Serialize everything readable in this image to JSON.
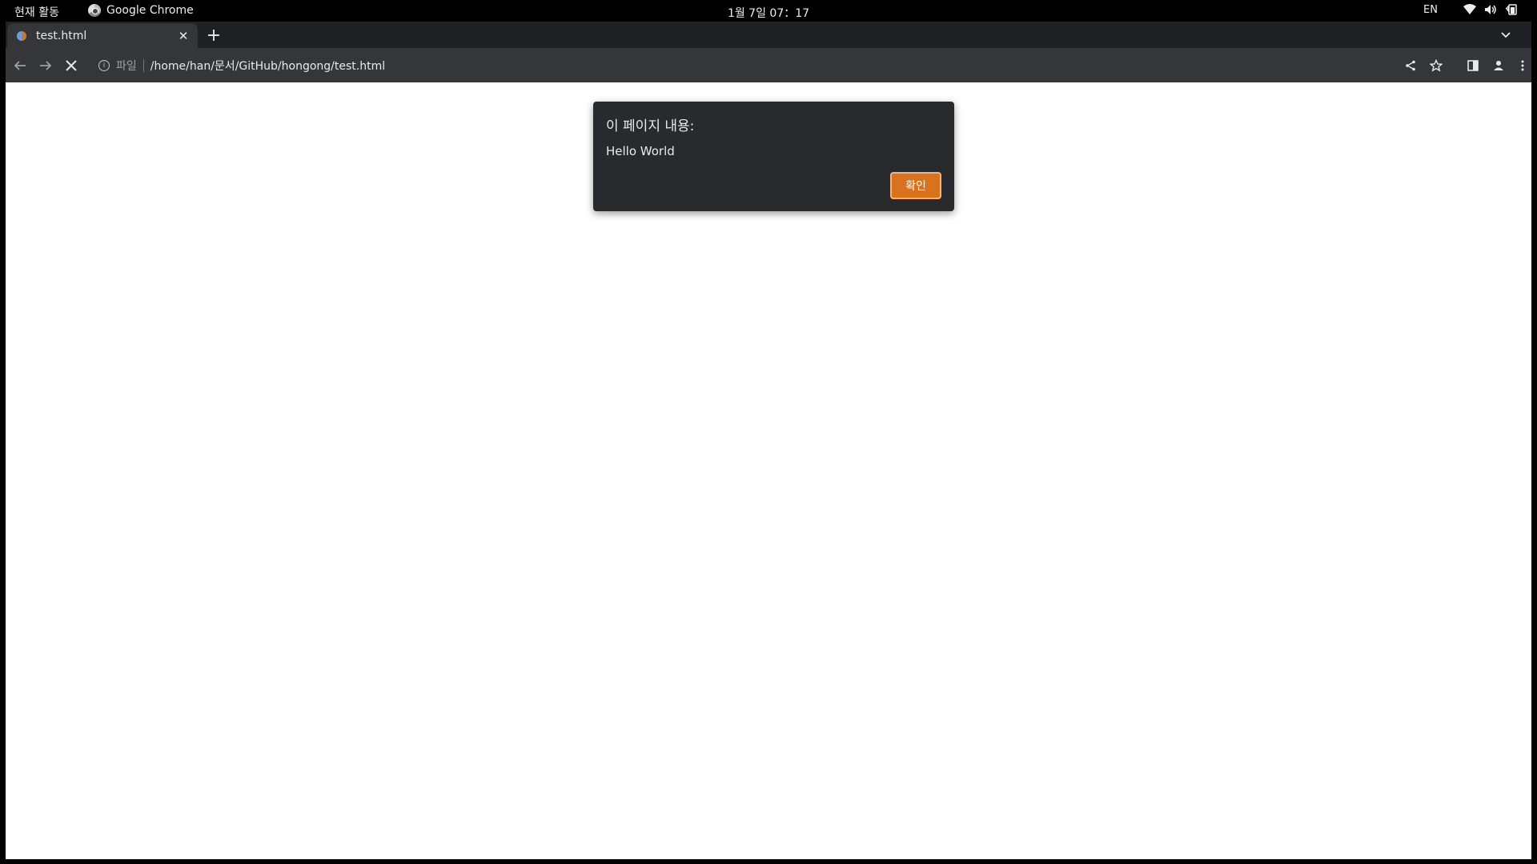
{
  "topbar": {
    "activities": "현재 활동",
    "app_name": "Google Chrome",
    "clock": "1월 7일 07：17",
    "language": "EN"
  },
  "tab": {
    "title": "test.html",
    "close_glyph": "✕"
  },
  "newtab_glyph": "+",
  "omnibox": {
    "chip": "파일",
    "url": "/home/han/문서/GitHub/hongong/test.html"
  },
  "dialog": {
    "heading": "이 페이지 내용:",
    "message": "Hello World",
    "ok_label": "확인"
  },
  "colors": {
    "accent": "#d7731e",
    "toolbar": "#35363a",
    "dialog_bg": "#292a2d"
  }
}
